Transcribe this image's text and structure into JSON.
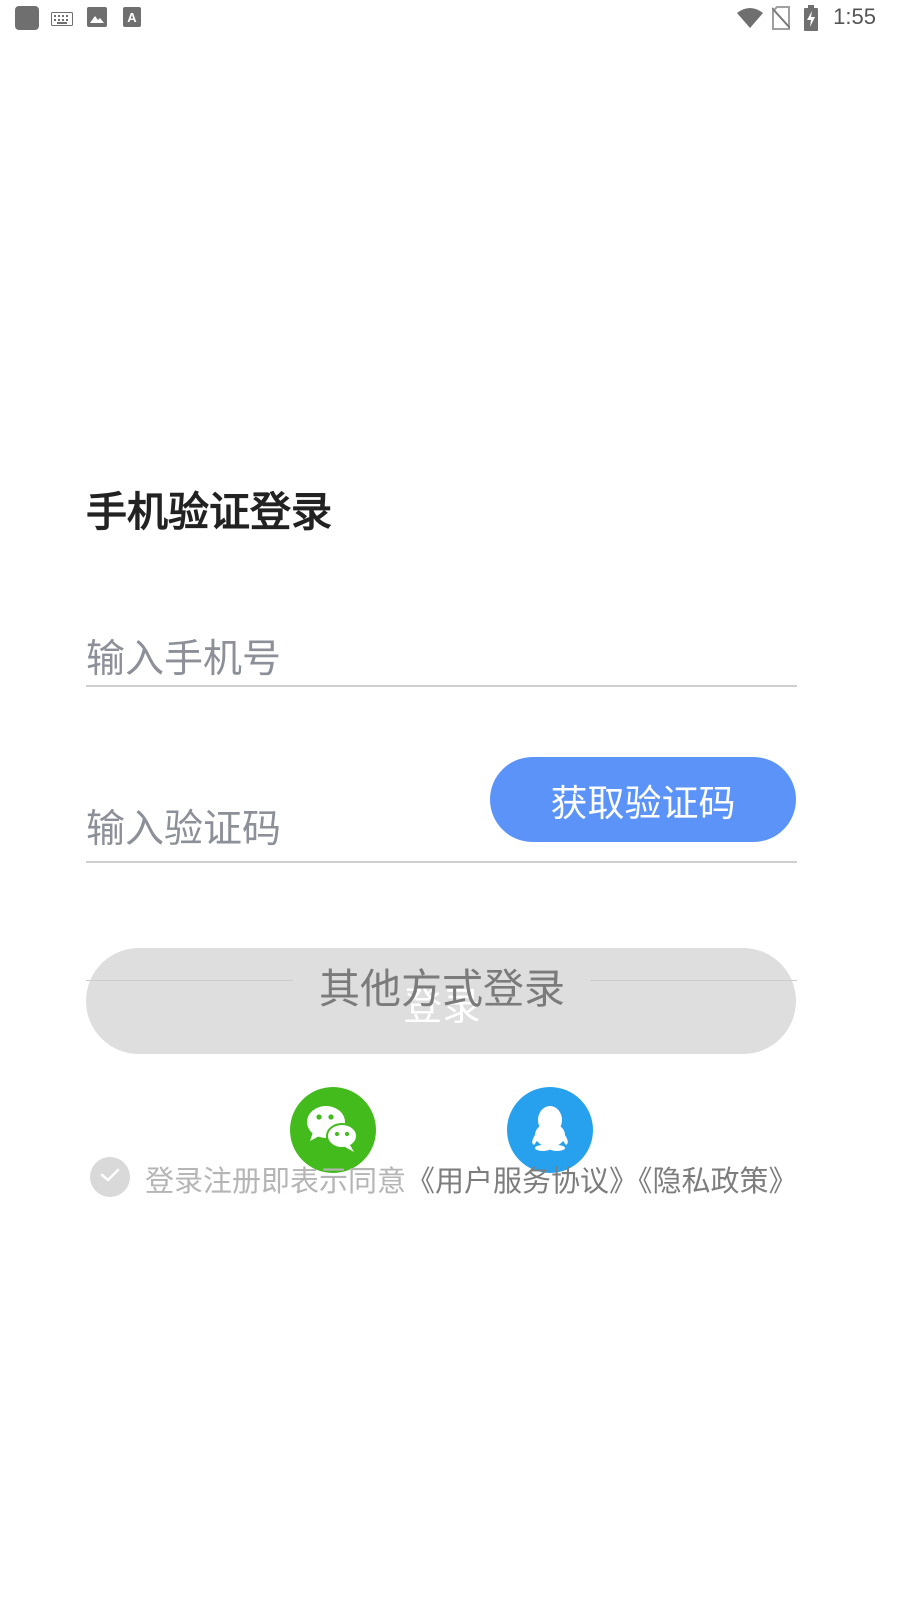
{
  "status_bar": {
    "time": "1:55",
    "left_icons": [
      "app-square-icon",
      "keyboard-icon",
      "image-icon",
      "font-a-icon"
    ],
    "right_icons": [
      "wifi-icon",
      "no-sim-icon",
      "battery-charging-icon"
    ]
  },
  "title": "手机验证登录",
  "phone_field": {
    "placeholder": "输入手机号"
  },
  "code_field": {
    "placeholder": "输入验证码"
  },
  "get_code_button": {
    "label": "获取验证码"
  },
  "login_button": {
    "label": "登录"
  },
  "other_login": {
    "label": "其他方式登录",
    "options": [
      {
        "icon": "wechat-icon",
        "color": "#44bb1d"
      },
      {
        "icon": "qq-icon",
        "color": "#27a1ee"
      }
    ]
  },
  "agreement": {
    "prefix": "登录注册即表示同意",
    "user_agreement": "《用户服务协议》",
    "privacy_policy": "《隐私政策》"
  },
  "colors": {
    "accent": "#5b93f9",
    "login_button_bg": "#dedede",
    "wechat": "#44bb1d",
    "qq": "#27a1ee"
  }
}
